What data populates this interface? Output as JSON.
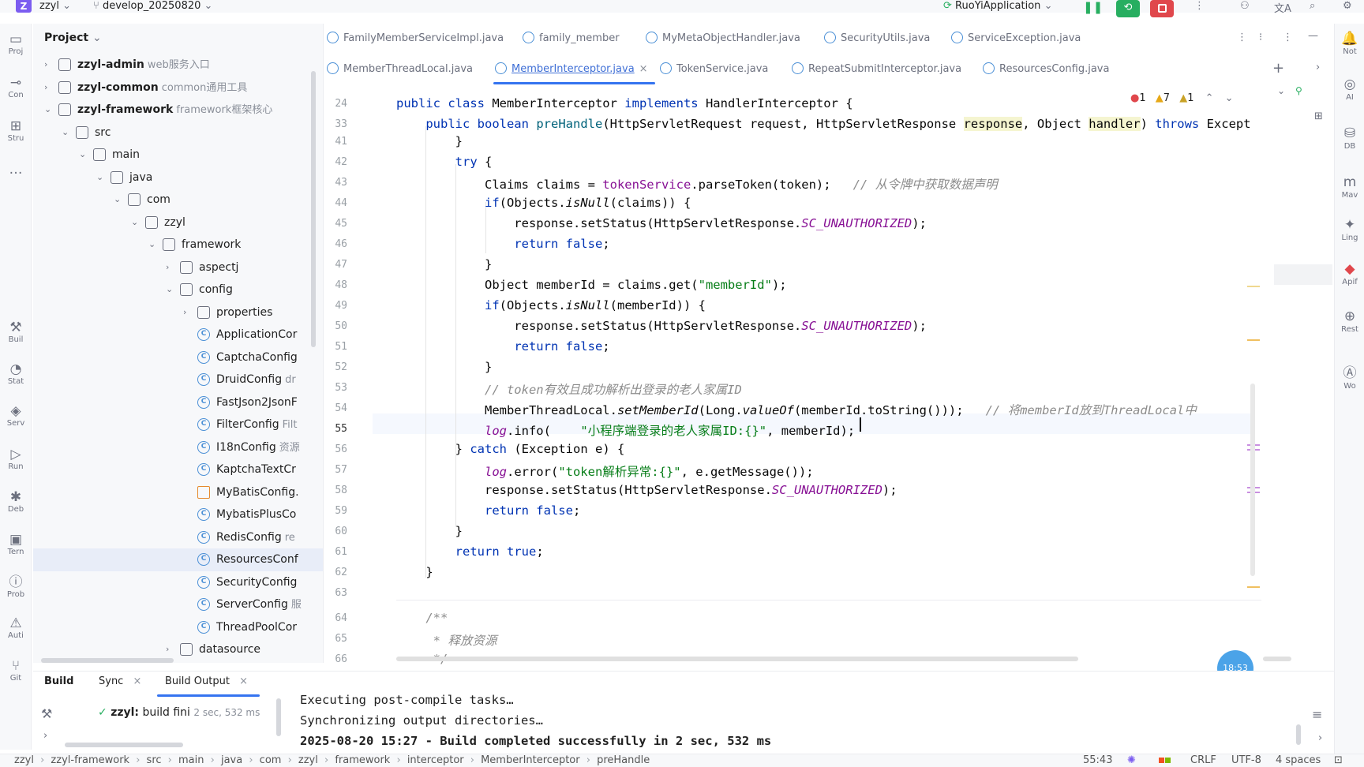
{
  "titlebar": {
    "logo": "Z",
    "project": "zzyl",
    "branch": "develop_20250820",
    "run_config": "RuoYiApplication"
  },
  "left_strip": [
    {
      "glyph": "▭",
      "label": "Proj"
    },
    {
      "glyph": "⊸",
      "label": "Con"
    },
    {
      "glyph": "⊞",
      "label": "Stru"
    },
    {
      "glyph": "…",
      "label": ""
    },
    {
      "glyph": "⚒",
      "label": "Buil"
    },
    {
      "glyph": "◔",
      "label": "Stat"
    },
    {
      "glyph": "◈",
      "label": "Serv"
    },
    {
      "glyph": "▷",
      "label": "Run"
    },
    {
      "glyph": "✱",
      "label": "Deb"
    },
    {
      "glyph": "▣",
      "label": "Tern"
    },
    {
      "glyph": "ⓘ",
      "label": "Prob"
    },
    {
      "glyph": "⚠",
      "label": "Auti"
    },
    {
      "glyph": "⑂",
      "label": "Git"
    }
  ],
  "project_panel": {
    "title": "Project",
    "rows": [
      {
        "indent": 0,
        "chev": "›",
        "label": "zzyl-admin",
        "sub": "web服务入口",
        "bold": true
      },
      {
        "indent": 0,
        "chev": "›",
        "label": "zzyl-common",
        "sub": "common通用工具",
        "bold": true
      },
      {
        "indent": 0,
        "chev": "⌄",
        "label": "zzyl-framework",
        "sub": "framework框架核心",
        "bold": true
      },
      {
        "indent": 1,
        "chev": "⌄",
        "label": "src",
        "sub": ""
      },
      {
        "indent": 2,
        "chev": "⌄",
        "label": "main",
        "sub": ""
      },
      {
        "indent": 3,
        "chev": "⌄",
        "label": "java",
        "sub": ""
      },
      {
        "indent": 4,
        "chev": "⌄",
        "label": "com",
        "sub": ""
      },
      {
        "indent": 5,
        "chev": "⌄",
        "label": "zzyl",
        "sub": ""
      },
      {
        "indent": 6,
        "chev": "⌄",
        "label": "framework",
        "sub": ""
      },
      {
        "indent": 7,
        "chev": "›",
        "label": "aspectj",
        "sub": ""
      },
      {
        "indent": 7,
        "chev": "⌄",
        "label": "config",
        "sub": ""
      },
      {
        "indent": 8,
        "chev": "›",
        "label": "properties",
        "sub": ""
      },
      {
        "indent": 8,
        "chev": "",
        "label": "ApplicationCor",
        "sub": "",
        "cls": true
      },
      {
        "indent": 8,
        "chev": "",
        "label": "CaptchaConfig",
        "sub": "",
        "cls": true
      },
      {
        "indent": 8,
        "chev": "",
        "label": "DruidConfig",
        "sub": "dr",
        "cls": true
      },
      {
        "indent": 8,
        "chev": "",
        "label": "FastJson2JsonF",
        "sub": "",
        "cls": true
      },
      {
        "indent": 8,
        "chev": "",
        "label": "FilterConfig",
        "sub": "Filt",
        "cls": true
      },
      {
        "indent": 8,
        "chev": "",
        "label": "I18nConfig",
        "sub": "资源",
        "cls": true
      },
      {
        "indent": 8,
        "chev": "",
        "label": "KaptchaTextCr",
        "sub": "",
        "cls": true
      },
      {
        "indent": 8,
        "chev": "",
        "label": "MyBatisConfig.",
        "sub": "",
        "xml": true
      },
      {
        "indent": 8,
        "chev": "",
        "label": "MybatisPlusCo",
        "sub": "",
        "cls": true
      },
      {
        "indent": 8,
        "chev": "",
        "label": "RedisConfig",
        "sub": "re",
        "cls": true
      },
      {
        "indent": 8,
        "chev": "",
        "label": "ResourcesConf",
        "sub": "",
        "cls": true,
        "selected": true
      },
      {
        "indent": 8,
        "chev": "",
        "label": "SecurityConfig",
        "sub": "",
        "cls": true
      },
      {
        "indent": 8,
        "chev": "",
        "label": "ServerConfig",
        "sub": "服",
        "cls": true
      },
      {
        "indent": 8,
        "chev": "",
        "label": "ThreadPoolCor",
        "sub": "",
        "cls": true
      },
      {
        "indent": 7,
        "chev": "›",
        "label": "datasource",
        "sub": ""
      }
    ]
  },
  "tabs_row1": [
    {
      "label": "FamilyMemberServiceImpl.java",
      "active": false
    },
    {
      "label": "family_member",
      "active": false
    },
    {
      "label": "MyMetaObjectHandler.java",
      "active": false
    },
    {
      "label": "SecurityUtils.java",
      "active": false
    },
    {
      "label": "ServiceException.java",
      "active": false
    }
  ],
  "tabs_row2": [
    {
      "label": "MemberThreadLocal.java",
      "active": false
    },
    {
      "label": "MemberInterceptor.java",
      "active": true
    },
    {
      "label": "TokenService.java",
      "active": false
    },
    {
      "label": "RepeatSubmitInterceptor.java",
      "active": false
    },
    {
      "label": "ResourcesConfig.java",
      "active": false
    }
  ],
  "inspections": {
    "errors": "1",
    "warnings": "7",
    "weak": "1"
  },
  "code": [
    {
      "n": "24",
      "html": "<span class=\"kw\">public class</span> MemberInterceptor <span class=\"kw\">implements</span> HandlerInterceptor {"
    },
    {
      "n": "33",
      "html": "    <span class=\"kw\">public boolean</span> <span class=\"fn\">preHandle</span>(HttpServletRequest request, HttpServletResponse <span style=\"background:#f5f5d0\">response</span>, Object <span style=\"background:#f5f5d0\">handler</span>) <span class=\"kw\">throws</span> Except"
    },
    {
      "n": "41",
      "html": "        }"
    },
    {
      "n": "42",
      "html": "        <span class=\"kw\">try</span> {"
    },
    {
      "n": "43",
      "html": "            Claims claims = <span class=\"fd\" style=\"font-style:normal\">tokenService</span>.parseToken(token);   <span class=\"cm\">// 从令牌中获取数据声明</span>"
    },
    {
      "n": "44",
      "html": "            <span class=\"kw\">if</span>(Objects.<span class=\"it\">isNull</span>(claims)) {"
    },
    {
      "n": "45",
      "html": "                response.setStatus(HttpServletResponse.<span class=\"fd\">SC_UNAUTHORIZED</span>);"
    },
    {
      "n": "46",
      "html": "                <span class=\"kw\">return false</span>;"
    },
    {
      "n": "47",
      "html": "            }"
    },
    {
      "n": "48",
      "html": "            Object memberId = claims.get(<span class=\"st\">\"memberId\"</span>);"
    },
    {
      "n": "49",
      "html": "            <span class=\"kw\">if</span>(Objects.<span class=\"it\">isNull</span>(memberId)) {"
    },
    {
      "n": "50",
      "html": "                response.setStatus(HttpServletResponse.<span class=\"fd\">SC_UNAUTHORIZED</span>);"
    },
    {
      "n": "51",
      "html": "                <span class=\"kw\">return false</span>;"
    },
    {
      "n": "52",
      "html": "            }"
    },
    {
      "n": "53",
      "html": "            <span class=\"cm\">// token有效且成功解析出登录的老人家属ID</span>"
    },
    {
      "n": "54",
      "html": "            MemberThreadLocal.<span class=\"it\">setMemberId</span>(Long.<span class=\"it\">valueOf</span>(memberId.toString()));   <span class=\"cm\">// 将memberId放到ThreadLocal中</span>"
    },
    {
      "n": "55",
      "html": "            <span class=\"fd\">log</span>.info(    <span class=\"st\">\"小程序端登录的老人家属ID:{}\"</span>, memberId);"
    },
    {
      "n": "56",
      "html": "        } <span class=\"kw\">catch</span> (Exception e) {"
    },
    {
      "n": "57",
      "html": "            <span class=\"fd\">log</span>.error(<span class=\"st\">\"token解析异常:{}\"</span>, e.getMessage());"
    },
    {
      "n": "58",
      "html": "            response.setStatus(HttpServletResponse.<span class=\"fd\">SC_UNAUTHORIZED</span>);"
    },
    {
      "n": "59",
      "html": "            <span class=\"kw\">return false</span>;"
    },
    {
      "n": "60",
      "html": "        }"
    },
    {
      "n": "61",
      "html": "        <span class=\"kw\">return true</span>;"
    },
    {
      "n": "62",
      "html": "    }"
    },
    {
      "n": "63",
      "html": ""
    },
    {
      "n": "64",
      "html": "    <span class=\"cm\">/**</span>"
    },
    {
      "n": "65",
      "html": "     <span class=\"cm\">* 释放资源</span>"
    },
    {
      "n": "66",
      "html": "     <span class=\"cm\">*/</span>"
    }
  ],
  "build_panel": {
    "tabs": [
      "Build",
      "Sync",
      "Build Output"
    ],
    "tree_item": "zzyl:",
    "tree_item_text": "build fini",
    "tree_item_time": "2 sec, 532 ms",
    "output": [
      "Executing post-compile tasks…",
      "Synchronizing output directories…",
      "2025-08-20 15:27 - Build completed successfully in 2 sec, 532 ms"
    ]
  },
  "timer_badge": "18:53",
  "statusbar": {
    "breadcrumbs": [
      "zzyl",
      "zzyl-framework",
      "src",
      "main",
      "java",
      "com",
      "zzyl",
      "framework",
      "interceptor",
      "MemberInterceptor",
      "preHandle"
    ],
    "position": "55:43",
    "line_sep": "CRLF",
    "encoding": "UTF-8",
    "indent": "4 spaces"
  },
  "right_strip": [
    {
      "glyph": "🔔",
      "label": "Not"
    },
    {
      "glyph": "◎",
      "label": "AI"
    },
    {
      "glyph": "⛁",
      "label": "DB"
    },
    {
      "glyph": "m",
      "label": "Mav"
    },
    {
      "glyph": "✦",
      "label": "Ling"
    },
    {
      "glyph": "◆",
      "label": "Apif"
    },
    {
      "glyph": "⊕",
      "label": "Rest"
    },
    {
      "glyph": "Ⓐ",
      "label": "Wo"
    }
  ],
  "colors": {
    "accent": "#3574f0",
    "run_green": "#27ae60",
    "stop_red": "#e0474c",
    "logo": "#7b5cf0"
  }
}
